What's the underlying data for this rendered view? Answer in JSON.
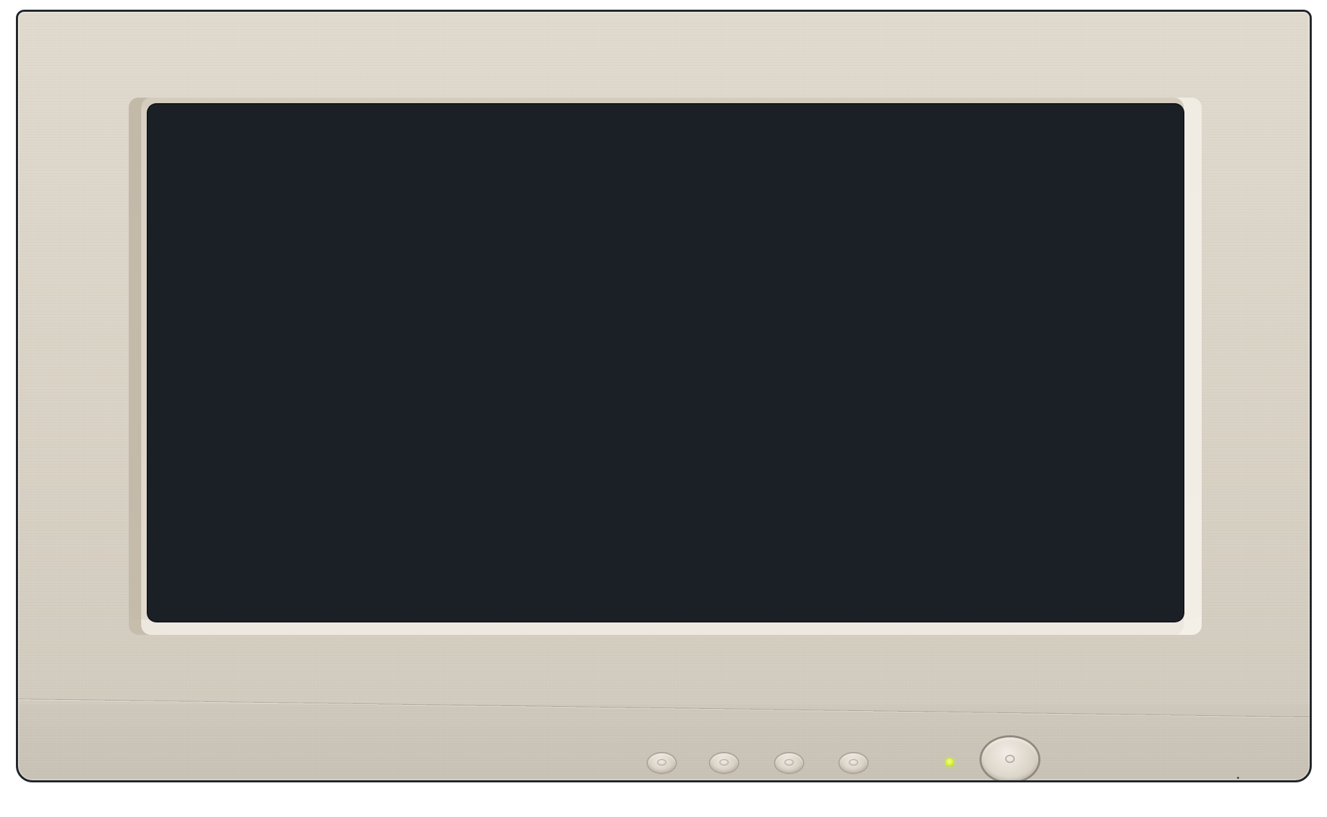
{
  "monitor": {
    "screen_state": "off",
    "controls": [
      {
        "name": "front-button-1",
        "icon": "round-button-icon"
      },
      {
        "name": "front-button-2",
        "icon": "round-button-icon"
      },
      {
        "name": "front-button-3",
        "icon": "round-button-icon"
      },
      {
        "name": "front-button-4",
        "icon": "round-button-icon"
      }
    ],
    "power_led": {
      "state": "on",
      "color": "#d6f22e"
    },
    "power_button": {
      "icon": "power-button-icon"
    }
  },
  "colors": {
    "bezel": "#ddd6c9",
    "screen": "#1b1f26",
    "outline": "#20242a"
  }
}
